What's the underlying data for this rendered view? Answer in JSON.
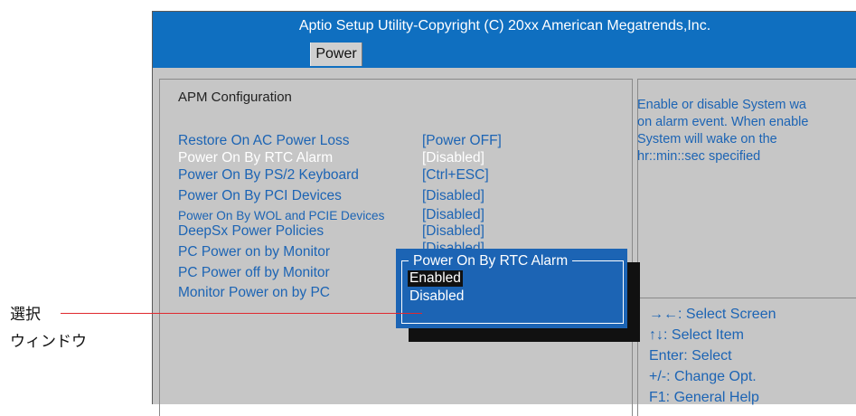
{
  "header": {
    "title": "Aptio Setup Utility-Copyright (C) 20xx American Megatrends,Inc.",
    "tab": "Power"
  },
  "section_title": "APM  Configuration",
  "settings": [
    {
      "label": "Restore On AC Power Loss",
      "value": "[Power OFF]"
    },
    {
      "label": "Power On By RTC Alarm",
      "value": "[Disabled]"
    },
    {
      "label": "Power On By PS/2 Keyboard",
      "value": "[Ctrl+ESC]"
    },
    {
      "label": "Power On By PCI Devices",
      "value": "[Disabled]"
    },
    {
      "label": "Power On By WOL and PCIE Devices",
      "value": "[Disabled]"
    },
    {
      "label": "DeepSx Power Policies",
      "value": "[Disabled]"
    },
    {
      "label": "PC Power on by Monitor",
      "value": "[Disabled]"
    },
    {
      "label": "PC Power off by Monitor",
      "value": ""
    },
    {
      "label": "Monitor Power on by PC",
      "value": ""
    }
  ],
  "help": {
    "lines": [
      "Enable or disable System wa",
      "on alarm event. When enable",
      "System will wake on the",
      "hr::min::sec specified"
    ]
  },
  "keys": [
    "→←: Select Screen",
    "↑↓: Select Item",
    "Enter: Select",
    "+/-: Change Opt.",
    "F1: General Help"
  ],
  "popup": {
    "title": "Power On By RTC Alarm",
    "options": [
      "Enabled",
      "Disabled"
    ],
    "selected": "Enabled"
  },
  "callout": {
    "line1": "選択",
    "line2": "ウィンドウ",
    "color": "#e0282e"
  },
  "colors": {
    "header_bg": "#0f6fc0",
    "text_blue": "#1c64b4",
    "panel_bg": "#c6c6c6"
  }
}
